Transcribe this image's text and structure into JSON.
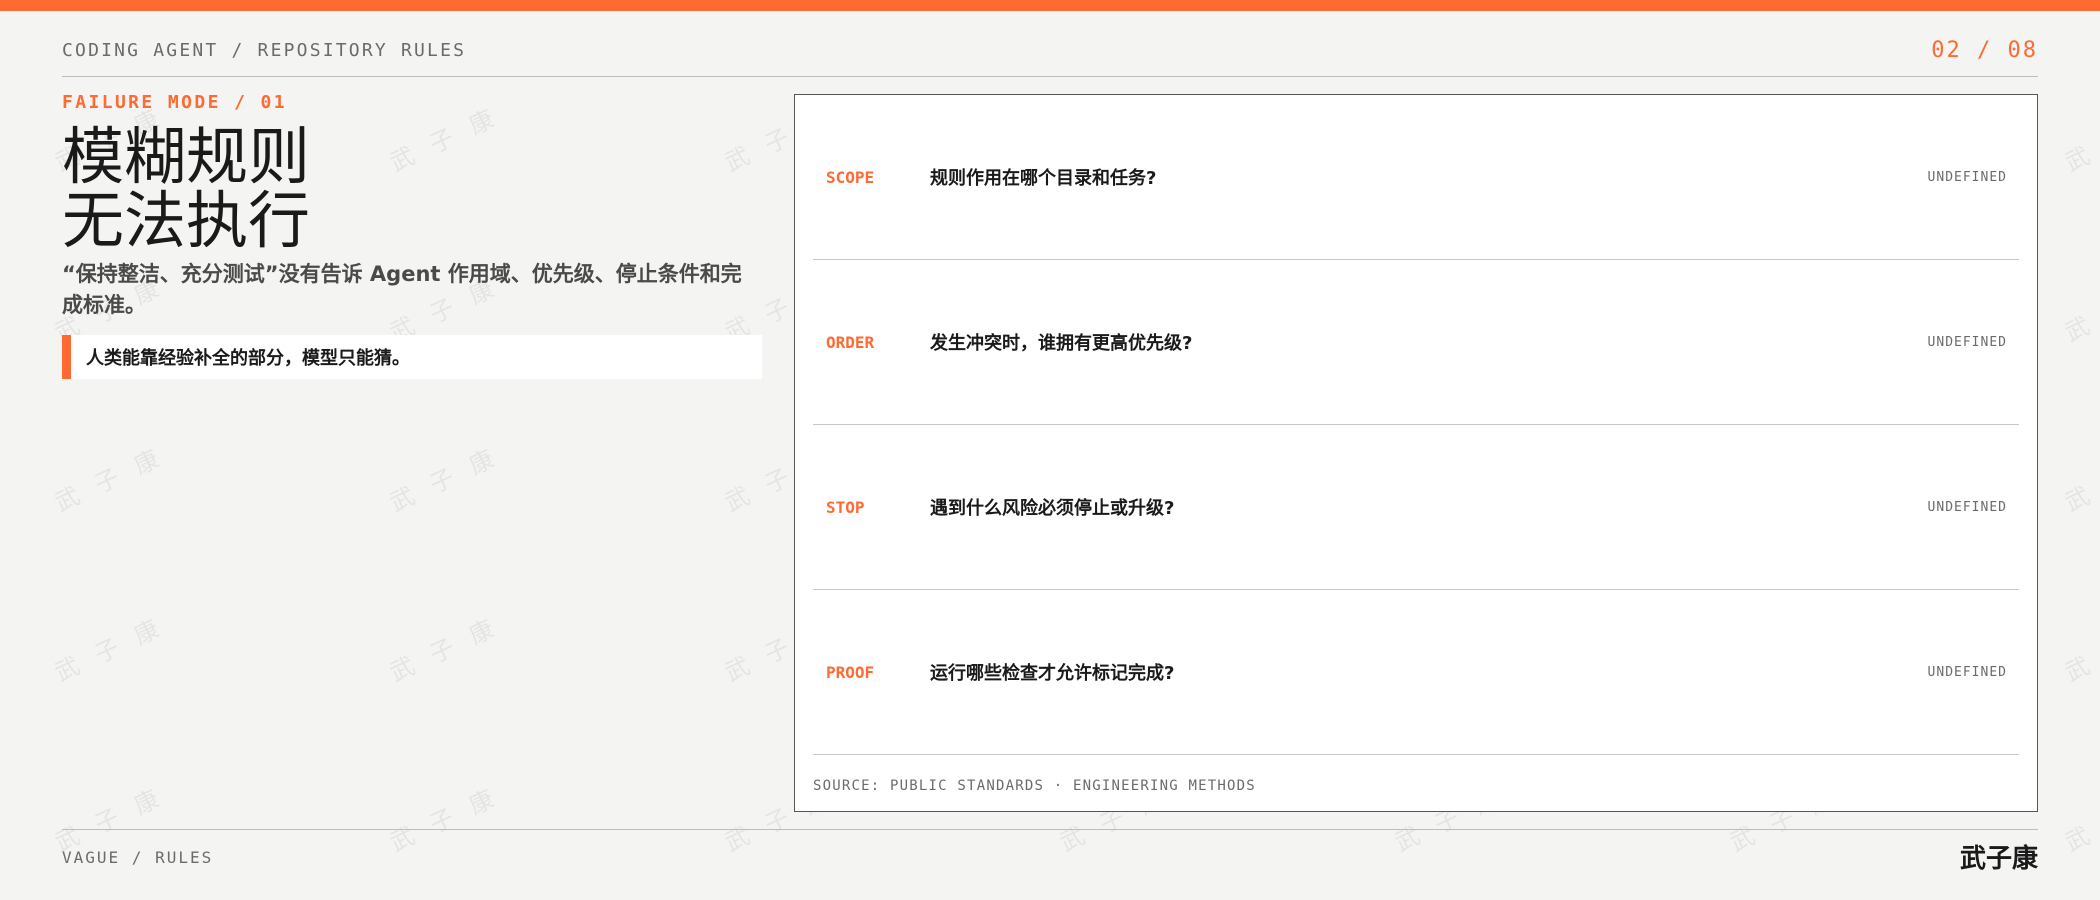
{
  "header": {
    "breadcrumb": "CODING AGENT / REPOSITORY RULES",
    "page_indicator": "02 / 08"
  },
  "left": {
    "kicker": "FAILURE MODE / 01",
    "title_line1": "模糊规则",
    "title_line2": "无法执行",
    "description": "“保持整洁、充分测试”没有告诉 Agent 作用域、优先级、停止条件和完成标准。",
    "callout": "人类能靠经验补全的部分，模型只能猜。"
  },
  "panel": {
    "rows": [
      {
        "tag": "SCOPE",
        "question": "规则作用在哪个目录和任务?",
        "status": "UNDEFINED"
      },
      {
        "tag": "ORDER",
        "question": "发生冲突时，谁拥有更高优先级?",
        "status": "UNDEFINED"
      },
      {
        "tag": "STOP",
        "question": "遇到什么风险必须停止或升级?",
        "status": "UNDEFINED"
      },
      {
        "tag": "PROOF",
        "question": "运行哪些检查才允许标记完成?",
        "status": "UNDEFINED"
      }
    ],
    "source": "SOURCE: PUBLIC STANDARDS · ENGINEERING METHODS"
  },
  "footer": {
    "left": "VAGUE / RULES",
    "brand": "武子康"
  },
  "watermark": {
    "text": "武 子 康"
  },
  "colors": {
    "accent": "#ff6a33",
    "background": "#f4f4f2"
  }
}
